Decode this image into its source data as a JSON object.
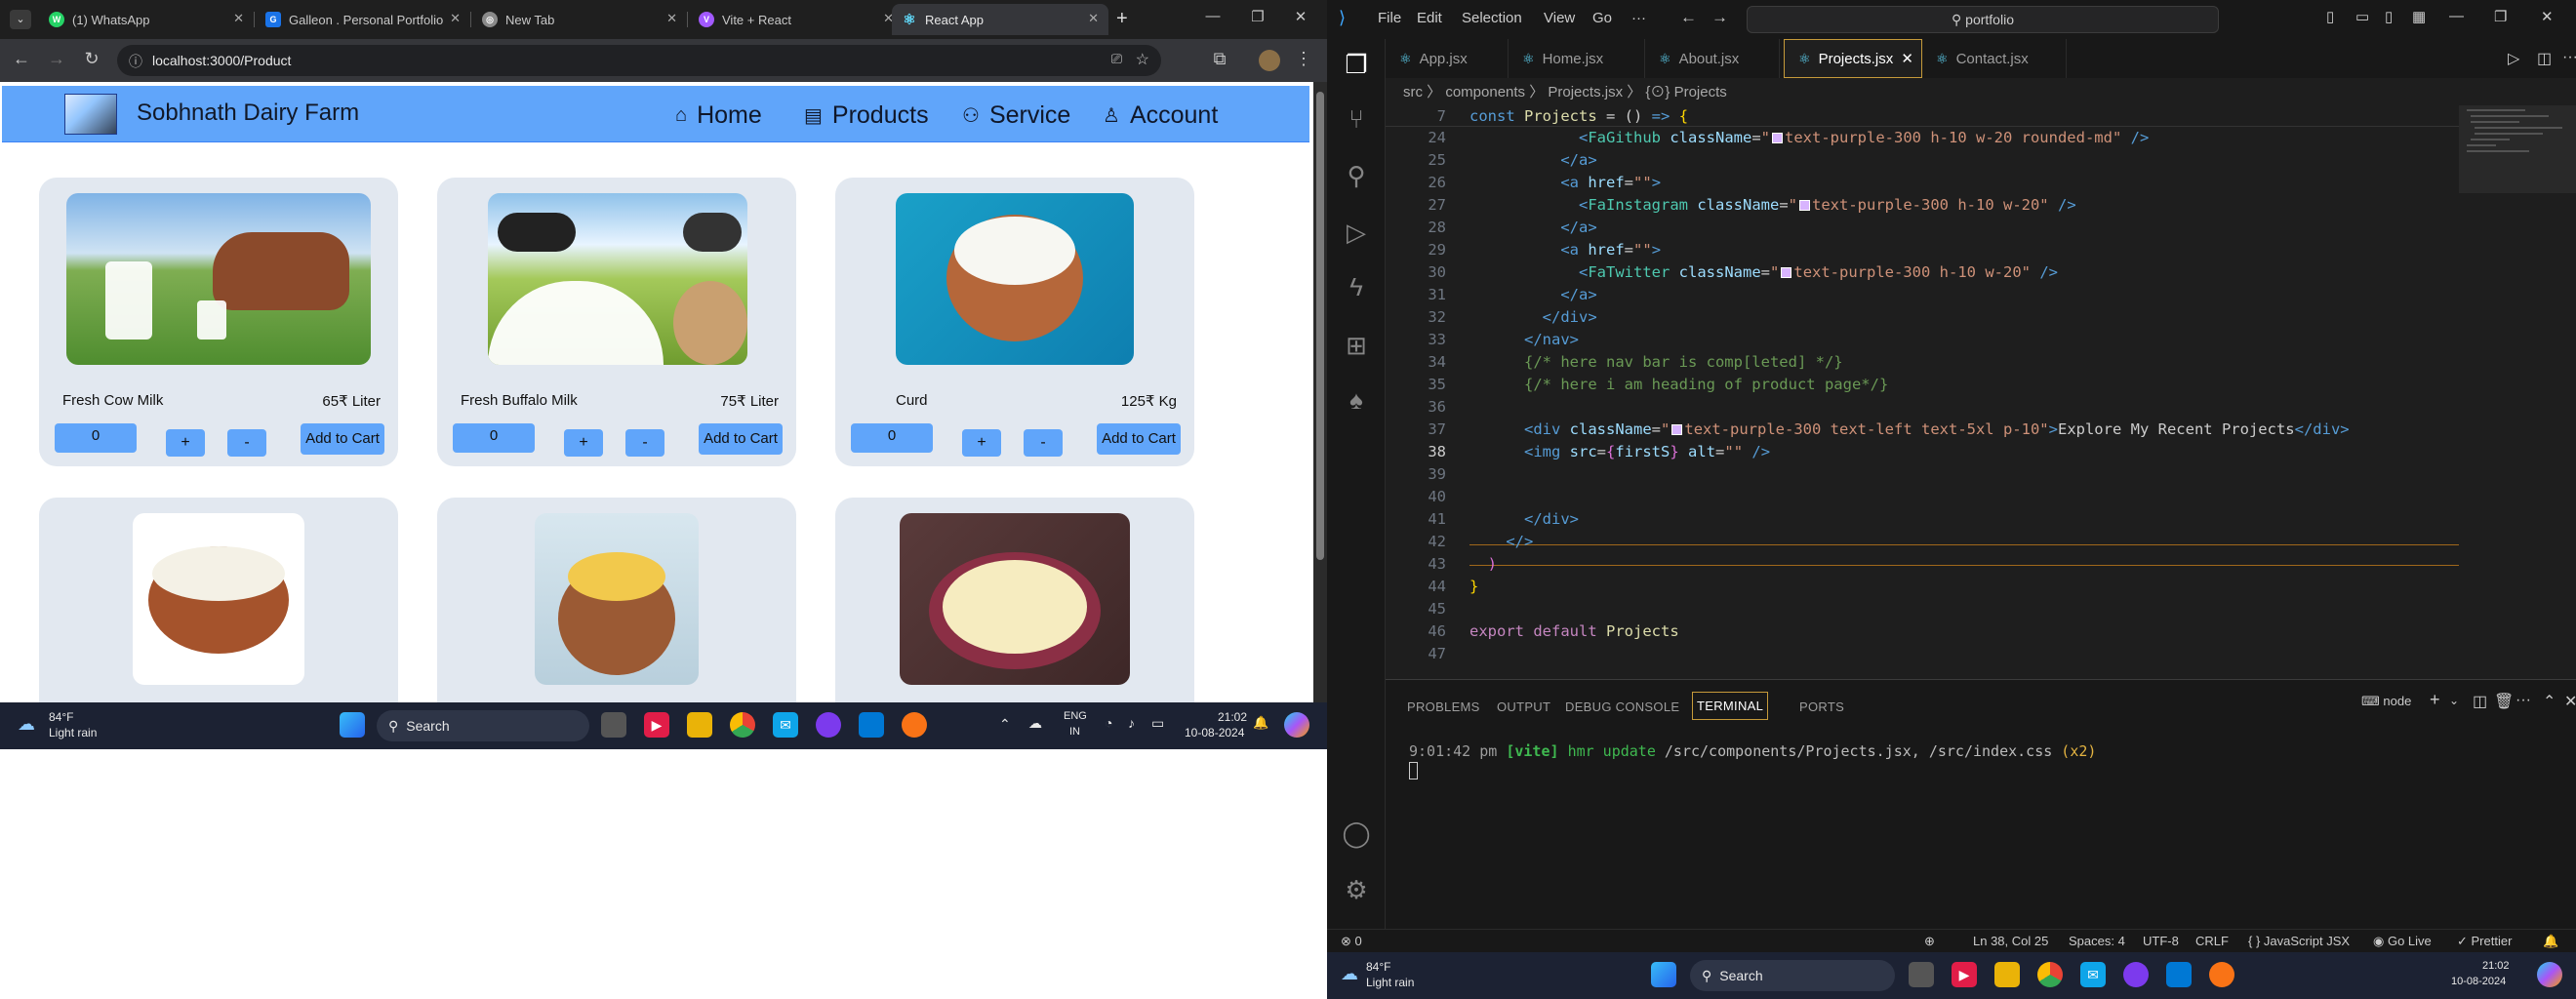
{
  "browser": {
    "tabs": [
      {
        "label": "(1) WhatsApp",
        "color": "#25d366",
        "glyph": "W"
      },
      {
        "label": "Galleon . Personal Portfolio",
        "color": "#1a73e8",
        "glyph": "G"
      },
      {
        "label": "New Tab",
        "color": "#8a8a8a",
        "glyph": "◎"
      },
      {
        "label": "Vite + React",
        "color": "#a259ff",
        "glyph": "V"
      },
      {
        "label": "React App",
        "color": "#61dafb",
        "glyph": "⚛"
      }
    ],
    "url": "localhost:3000/Product"
  },
  "site": {
    "brand": "Sobhnath Dairy Farm",
    "nav": [
      {
        "label": "Home",
        "icon": "⌂"
      },
      {
        "label": "Products",
        "icon": "▤"
      },
      {
        "label": "Service",
        "icon": "⚇"
      },
      {
        "label": "Account",
        "icon": "♙"
      }
    ],
    "products": [
      {
        "name": "Fresh Cow Milk",
        "price": "65₹  Liter",
        "qty": "0",
        "plus": "+",
        "minus": "-",
        "cart": "Add to Cart"
      },
      {
        "name": "Fresh Buffalo Milk",
        "price": "75₹  Liter",
        "qty": "0",
        "plus": "+",
        "minus": "-",
        "cart": "Add to Cart"
      },
      {
        "name": "Curd",
        "price": "125₹  Kg",
        "qty": "0",
        "plus": "+",
        "minus": "-",
        "cart": "Add to Cart"
      }
    ]
  },
  "taskbar_left": {
    "weather_temp": "84°F",
    "weather_desc": "Light rain",
    "search": "Search",
    "lang": "ENG",
    "region": "IN",
    "time": "21:02",
    "date": "10-08-2024"
  },
  "vscode": {
    "menu": [
      "File",
      "Edit",
      "Selection",
      "View",
      "Go",
      "···"
    ],
    "search": "portfolio",
    "tabs": [
      "App.jsx",
      "Home.jsx",
      "About.jsx",
      "Projects.jsx",
      "Contact.jsx"
    ],
    "breadcrumb": "src  〉 components  〉 Projects.jsx  〉 {⊙} Projects",
    "sticky_line": "7",
    "line_numbers": [
      "24",
      "25",
      "26",
      "27",
      "28",
      "29",
      "30",
      "31",
      "32",
      "33",
      "34",
      "35",
      "36",
      "37",
      "38",
      "39",
      "40",
      "41",
      "42",
      "43",
      "44",
      "45",
      "46",
      "47"
    ],
    "panel_tabs": [
      "PROBLEMS",
      "OUTPUT",
      "DEBUG CONSOLE",
      "TERMINAL",
      "PORTS"
    ],
    "terminal_time": "9:01:42 pm",
    "terminal_vite": "[vite]",
    "terminal_hmr": "hmr update",
    "terminal_files": "/src/components/Projects.jsx, /src/index.css",
    "terminal_count": "(x2)",
    "shell": "node",
    "status": {
      "ports": "⊗ 0",
      "pos": "Ln 38, Col 25",
      "spaces": "Spaces: 4",
      "enc": "UTF-8",
      "eol": "CRLF",
      "lang": "{ } JavaScript JSX",
      "golive": "Go Live",
      "prettier": "✓ Prettier"
    }
  },
  "taskbar_right": {
    "weather_temp": "84°F",
    "weather_desc": "Light rain",
    "search": "Search",
    "time": "21:02",
    "date": "10-08-2024"
  }
}
